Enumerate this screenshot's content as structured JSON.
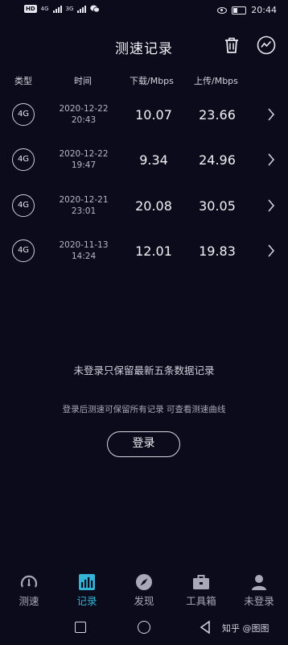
{
  "status_bar": {
    "hd_label": "HD",
    "net1": "4G",
    "net2": "3G",
    "time": "20:44"
  },
  "header": {
    "title": "测速记录"
  },
  "columns": {
    "type": "类型",
    "time": "时间",
    "download": "下载/Mbps",
    "upload": "上传/Mbps"
  },
  "records": [
    {
      "type": "4G",
      "date": "2020-12-22",
      "time": "20:43",
      "download": "10.07",
      "upload": "23.66"
    },
    {
      "type": "4G",
      "date": "2020-12-22",
      "time": "19:47",
      "download": "9.34",
      "upload": "24.96"
    },
    {
      "type": "4G",
      "date": "2020-12-21",
      "time": "23:01",
      "download": "20.08",
      "upload": "30.05"
    },
    {
      "type": "4G",
      "date": "2020-11-13",
      "time": "14:24",
      "download": "12.01",
      "upload": "19.83"
    }
  ],
  "notice": {
    "main": "未登录只保留最新五条数据记录",
    "sub": "登录后测速可保留所有记录 可查看测速曲线",
    "login_button": "登录"
  },
  "tabs": [
    {
      "label": "测速",
      "icon": "speedometer-icon",
      "active": false
    },
    {
      "label": "记录",
      "icon": "records-chart-icon",
      "active": true
    },
    {
      "label": "发现",
      "icon": "compass-icon",
      "active": false
    },
    {
      "label": "工具箱",
      "icon": "toolbox-icon",
      "active": false
    },
    {
      "label": "未登录",
      "icon": "user-icon",
      "active": false
    }
  ],
  "watermark": "知乎 @图图",
  "colors": {
    "background": "#0b0b1c",
    "accent": "#34b3d6"
  }
}
